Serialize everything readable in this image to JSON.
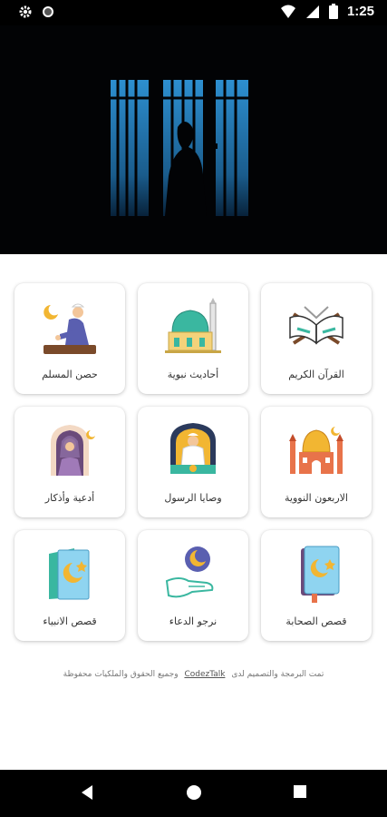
{
  "status_bar": {
    "time": "1:25",
    "icons": [
      "settings-icon",
      "circle-icon",
      "wifi-icon",
      "signal-icon",
      "battery-icon"
    ]
  },
  "hero": {
    "description_icon": "praying-silhouette-image"
  },
  "menu": [
    {
      "label": "القرآن الكريم",
      "icon": "quran-book-icon"
    },
    {
      "label": "أحاديث نبوية",
      "icon": "mosque-dome-icon"
    },
    {
      "label": "حصن المسلم",
      "icon": "praying-man-icon"
    },
    {
      "label": "الاربعون النووية",
      "icon": "mosque-icon"
    },
    {
      "label": "وصايا الرسول",
      "icon": "imam-mihrab-icon"
    },
    {
      "label": "أدعية وأذكار",
      "icon": "praying-woman-icon"
    },
    {
      "label": "قصص الصحابة",
      "icon": "book-crescent-icon"
    },
    {
      "label": "نرجو الدعاء",
      "icon": "hand-crescent-icon"
    },
    {
      "label": "قصص الانبياء",
      "icon": "card-crescent-icon"
    }
  ],
  "footer": {
    "prefix": "تمت البرمجة والتصميم لدى",
    "brand": "CodezTalk",
    "suffix": "وجميع الحقوق والملكيات محفوظة"
  },
  "nav": {
    "icons": [
      "back-icon",
      "home-icon",
      "recents-icon"
    ]
  },
  "colors": {
    "accent_teal": "#3ab7a0",
    "hero_blue": "#1e6fa8",
    "card_bg": "#ffffff"
  }
}
